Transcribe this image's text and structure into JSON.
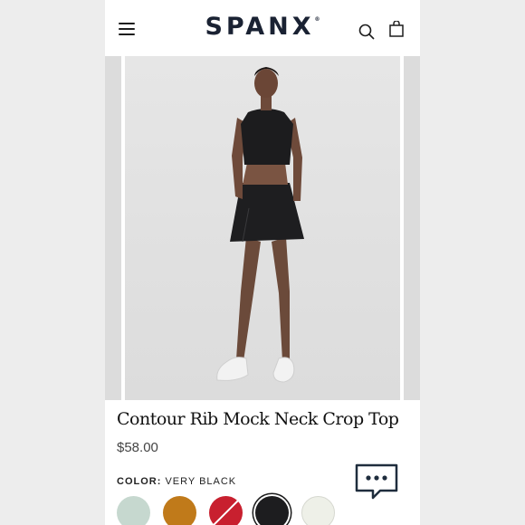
{
  "header": {
    "brand": "SPANX",
    "brand_mark": "®",
    "icons": {
      "menu": "menu-icon",
      "search": "search-icon",
      "bag": "shopping-bag-icon"
    }
  },
  "product": {
    "title": "Contour Rib Mock Neck Crop Top",
    "price": "$58.00",
    "color_label": "COLOR:",
    "color_value": "VERY BLACK",
    "swatches": [
      {
        "name": "sage",
        "color": "#c6d8cf",
        "selected": false,
        "unavailable": false
      },
      {
        "name": "amber",
        "color": "#c07a1a",
        "selected": false,
        "unavailable": false
      },
      {
        "name": "red",
        "color": "#c8202f",
        "selected": false,
        "unavailable": true
      },
      {
        "name": "very-black",
        "color": "#1d1d1f",
        "selected": true,
        "unavailable": false
      },
      {
        "name": "ivory",
        "color": "#eef0e8",
        "selected": false,
        "unavailable": false
      }
    ]
  },
  "chat": {
    "icon": "chat-bubble-icon"
  }
}
